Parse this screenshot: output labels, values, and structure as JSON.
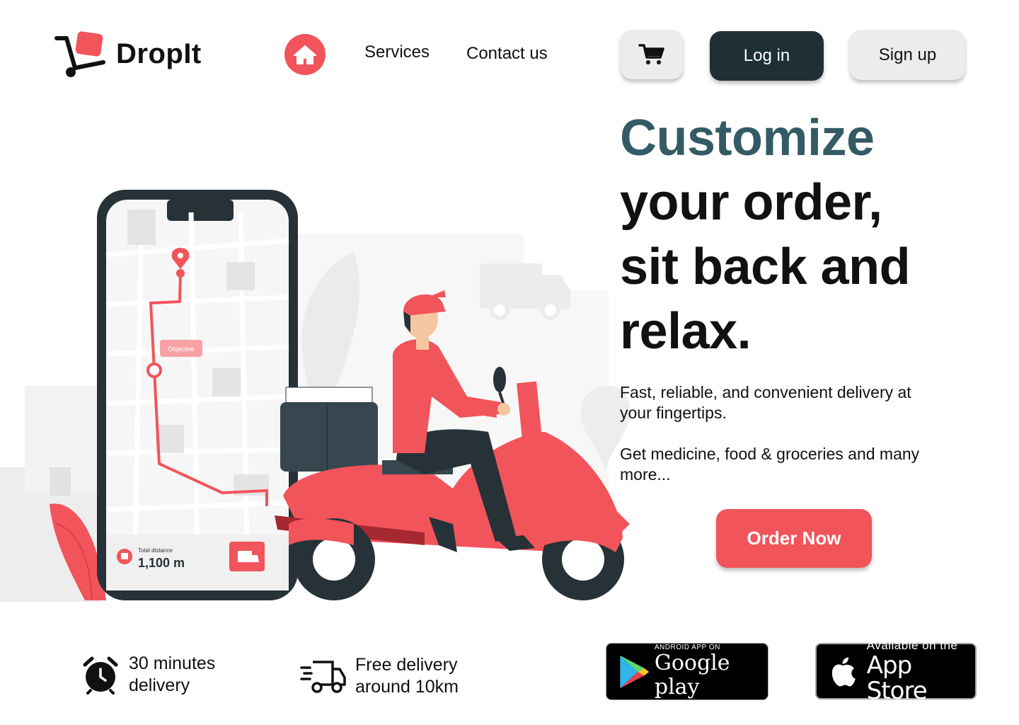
{
  "brand": {
    "name": "DropIt",
    "accent": "#f2545b",
    "dark": "#1e2f36",
    "headline_accent": "#345b65"
  },
  "nav": {
    "home_icon": "home-icon",
    "services": "Services",
    "contact": "Contact us"
  },
  "header": {
    "cart_icon": "cart-icon",
    "login": "Log in",
    "signup": "Sign up"
  },
  "hero": {
    "line1": "Customize",
    "line2": "your order,",
    "line3": "sit back and",
    "line4": "relax.",
    "sub1": "Fast, reliable, and convenient delivery at your fingertips.",
    "sub2": "Get medicine, food & groceries and many more...",
    "cta": "Order Now"
  },
  "illustration": {
    "pin_label": "Objective",
    "distance_label": "Total distance",
    "distance_value": "1,100 m"
  },
  "features": [
    {
      "icon": "alarm-clock-icon",
      "line1": "30 minutes",
      "line2": "delivery"
    },
    {
      "icon": "delivery-truck-icon",
      "line1": "Free delivery",
      "line2": "around 10km"
    }
  ],
  "stores": {
    "google_small": "ANDROID APP ON",
    "google_big": "Google play",
    "apple_small": "Available on the",
    "apple_big": "App Store"
  }
}
